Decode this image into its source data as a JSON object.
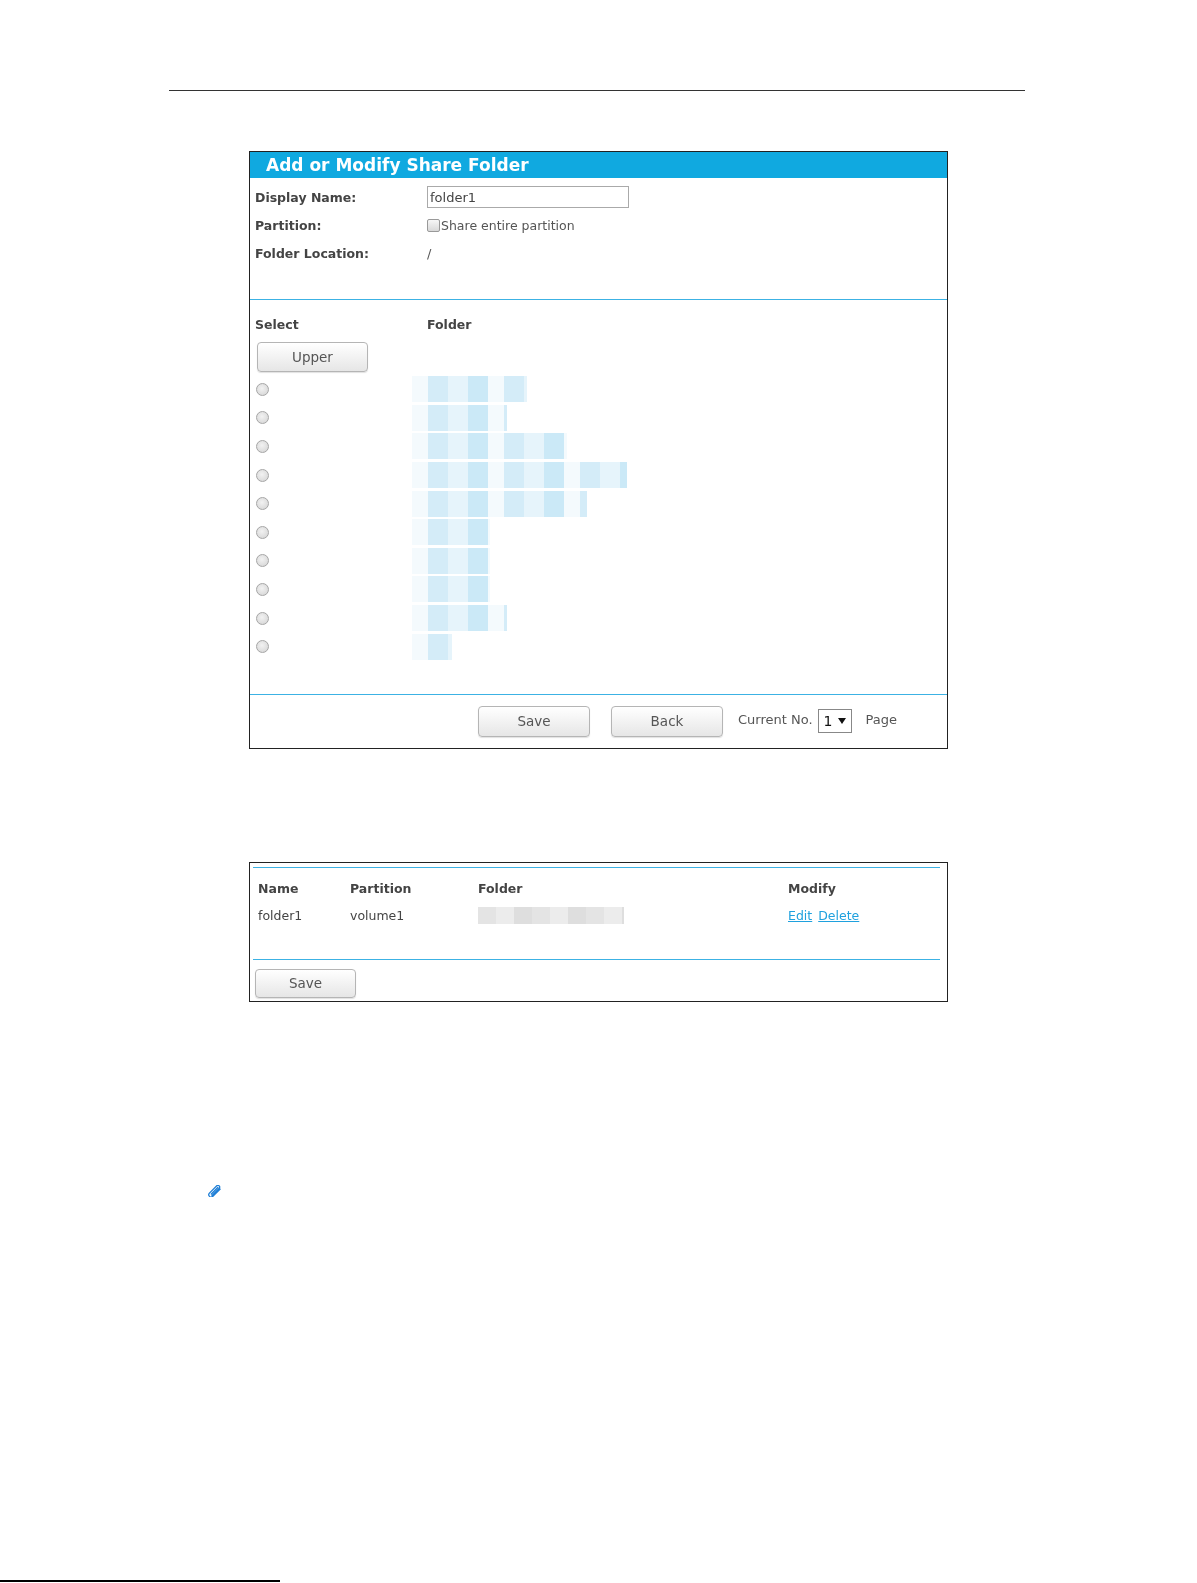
{
  "section": {
    "title": "Add or Modify Share Folder",
    "fields": [
      {
        "kind": "input",
        "label": "Display Name:",
        "value": "folder1"
      },
      {
        "kind": "checkbox",
        "label": "Partition:",
        "text": "Share entire partition",
        "checked": false
      },
      {
        "kind": "text",
        "label": "Folder Location:",
        "value": "/"
      }
    ],
    "browser": {
      "columns": [
        "Select",
        "Folder"
      ],
      "upper_button": "Upper",
      "folders": [
        {
          "selected": false
        },
        {
          "selected": false
        },
        {
          "selected": false
        },
        {
          "selected": false
        },
        {
          "selected": false
        },
        {
          "selected": false
        },
        {
          "selected": false
        },
        {
          "selected": false
        },
        {
          "selected": false
        },
        {
          "selected": false
        }
      ]
    },
    "footer": {
      "buttons": [
        "Save",
        "Back"
      ],
      "current_label": "Current No.",
      "page_value": "1",
      "page_suffix": "Page"
    }
  },
  "share_table": {
    "columns": [
      "Name",
      "Partition",
      "Folder",
      "Modify"
    ],
    "rows": [
      {
        "name": "folder1",
        "partition": "volume1",
        "actions": [
          "Edit",
          "Delete"
        ]
      }
    ],
    "save_button": "Save"
  }
}
